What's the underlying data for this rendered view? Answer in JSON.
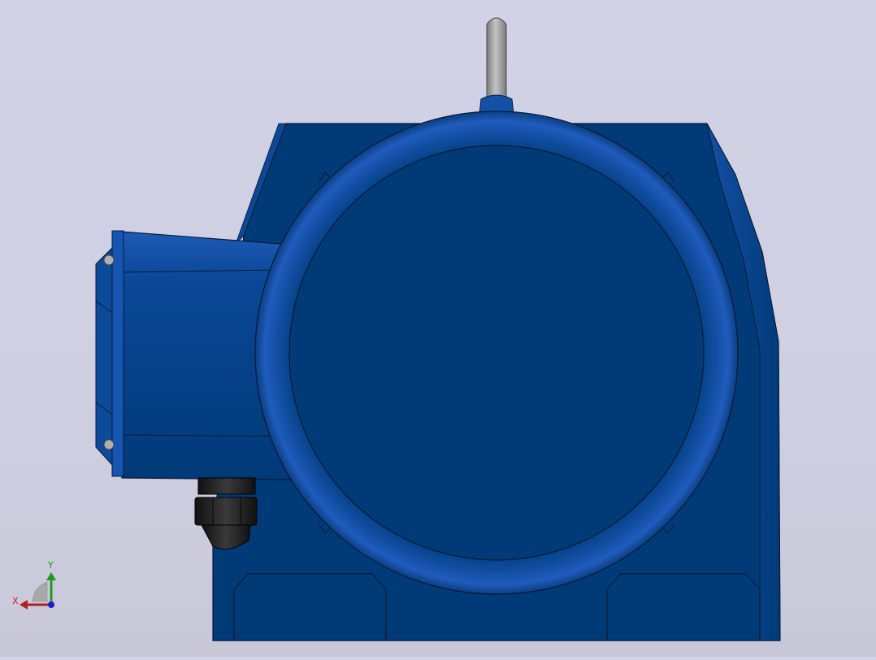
{
  "viewport": {
    "background_top": "#d2d2e6",
    "background_bottom": "#c8c8d8",
    "model": {
      "body_color": "#003b78",
      "highlight_color": "#1a56b0",
      "edge_color": "#0a1a33",
      "lifting_eye_color": "#9a9a9a",
      "cable_gland_color": "#1c1c1c"
    }
  },
  "triad": {
    "x_label": "X",
    "y_label": "Y",
    "x_color": "#c81e1e",
    "y_color": "#1e9a1e",
    "z_color": "#1e1ec8"
  }
}
